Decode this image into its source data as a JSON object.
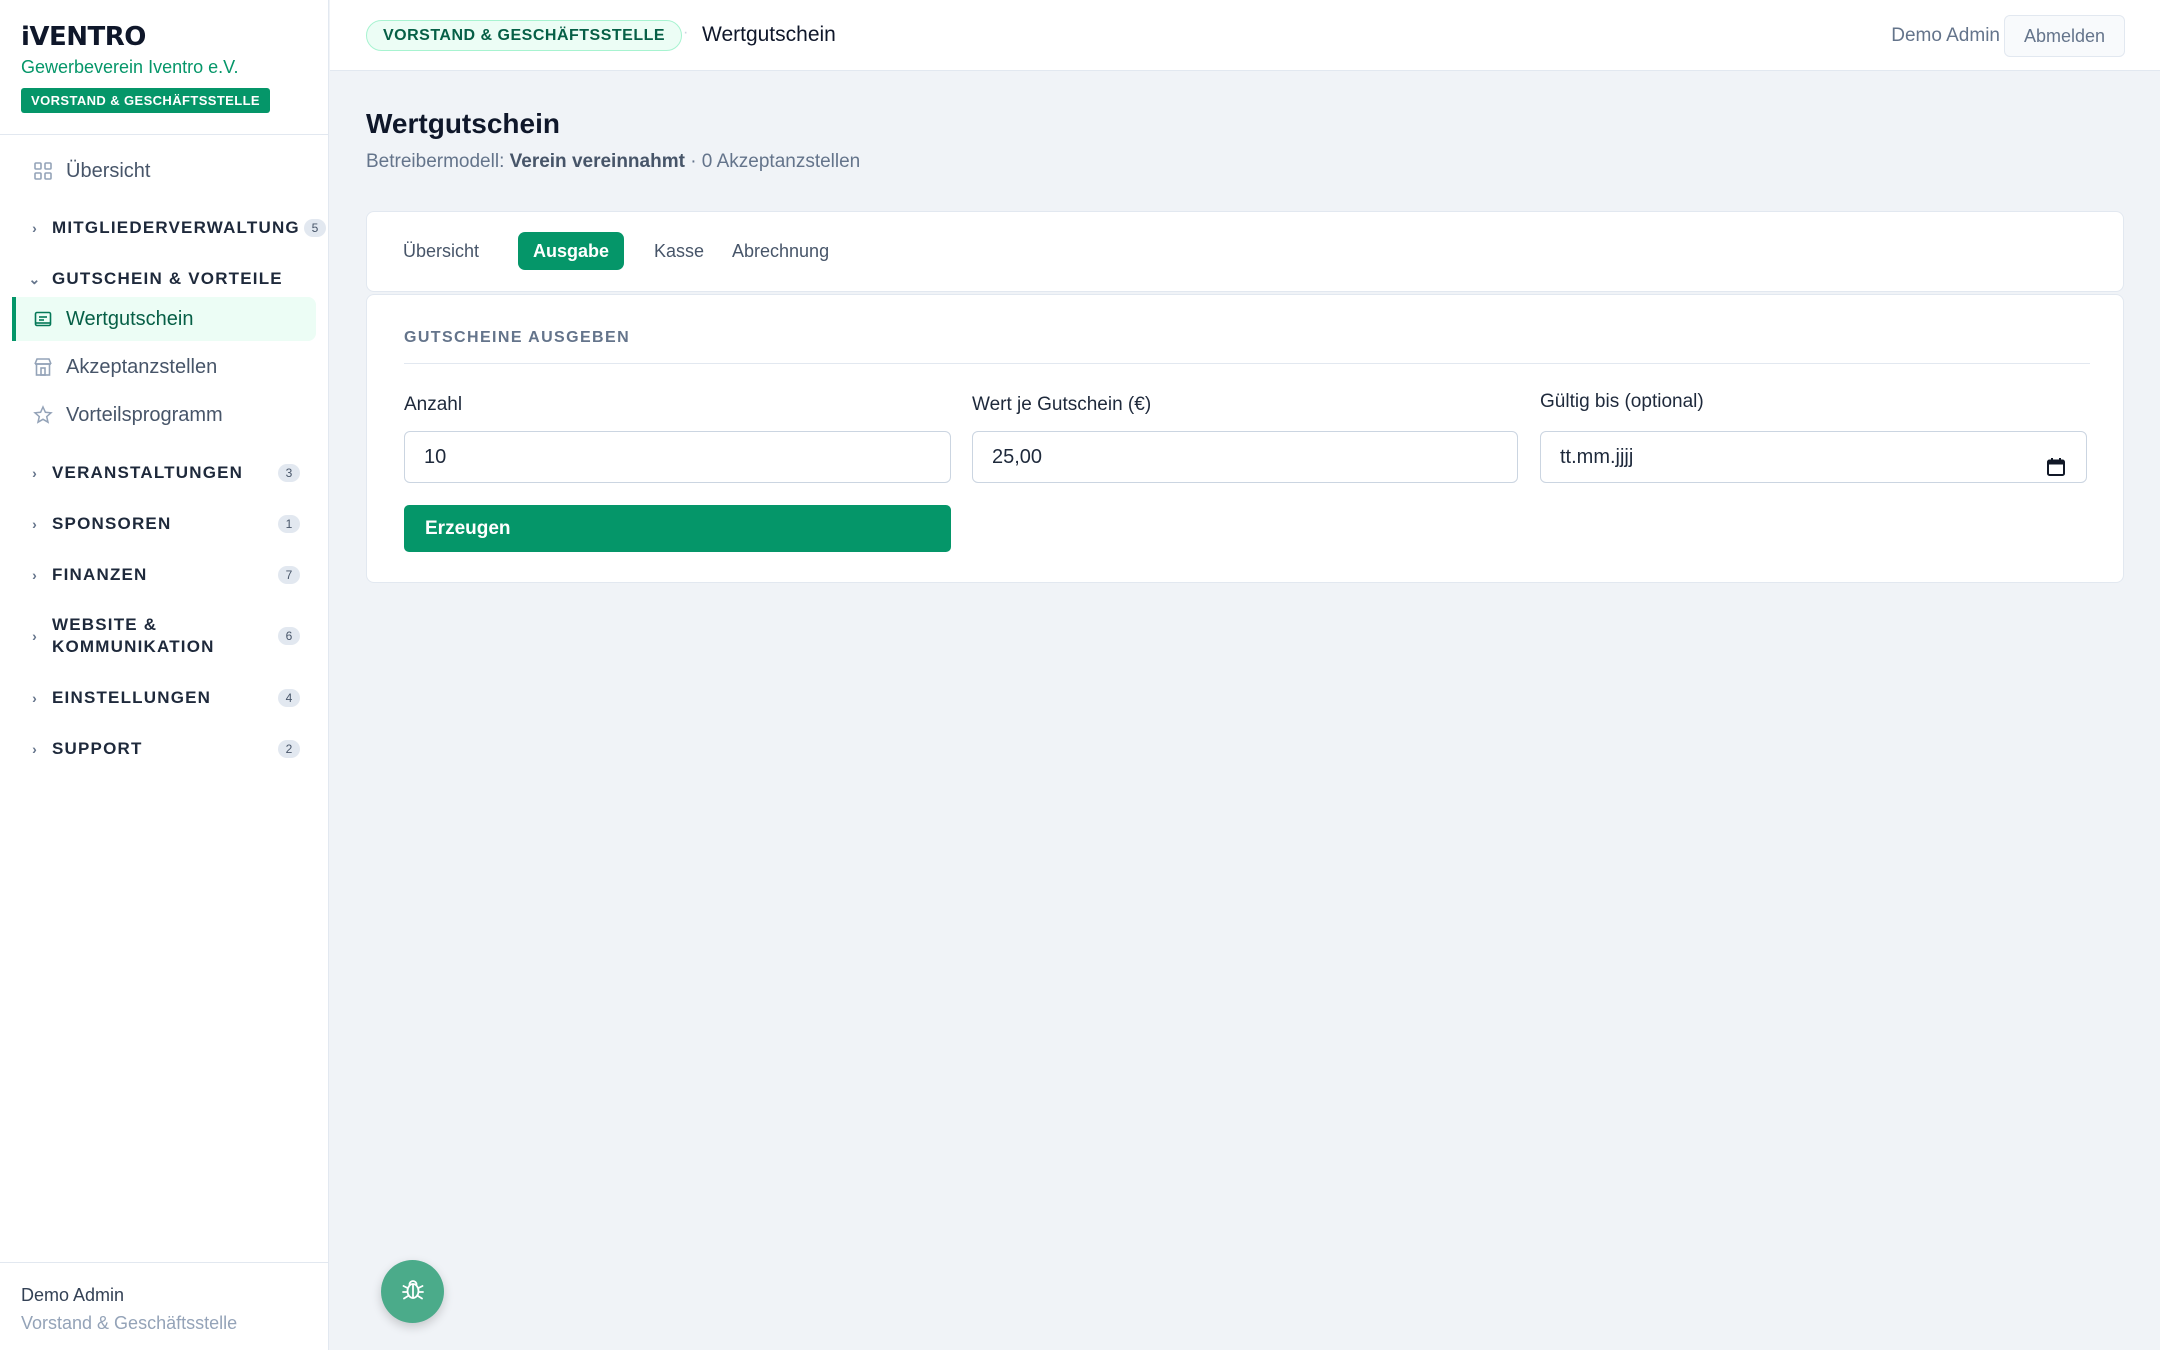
{
  "brand": {
    "name": "iVENTRO",
    "org": "Gewerbeverein Iventro e.V.",
    "role_badge": "VORSTAND & GESCHÄFTSSTELLE"
  },
  "sidebar": {
    "overview": {
      "label": "Übersicht",
      "icon": "grid-icon"
    },
    "groups": [
      {
        "label": "MITGLIEDERVERWALTUNG",
        "count": "5",
        "expanded": false
      },
      {
        "label": "GUTSCHEIN & VORTEILE",
        "expanded": true,
        "items": [
          {
            "label": "Wertgutschein",
            "icon": "voucher-icon",
            "active": true
          },
          {
            "label": "Akzeptanzstellen",
            "icon": "store-icon"
          },
          {
            "label": "Vorteilsprogramm",
            "icon": "star-icon"
          }
        ]
      },
      {
        "label": "VERANSTALTUNGEN",
        "count": "3"
      },
      {
        "label": "SPONSOREN",
        "count": "1"
      },
      {
        "label": "FINANZEN",
        "count": "7"
      },
      {
        "label_line1": "WEBSITE &",
        "label_line2": "KOMMUNIKATION",
        "count": "6"
      },
      {
        "label": "EINSTELLUNGEN",
        "count": "4"
      },
      {
        "label": "SUPPORT",
        "count": "2"
      }
    ],
    "footer": {
      "user": "Demo Admin",
      "role": "Vorstand & Geschäftsstelle"
    }
  },
  "topbar": {
    "badge": "VORSTAND & GESCHÄFTSSTELLE",
    "separator": "·",
    "title": "Wertgutschein",
    "user": "Demo Admin",
    "logout_label": "Abmelden"
  },
  "page": {
    "title": "Wertgutschein",
    "subtitle_prefix": "Betreibermodell: ",
    "subtitle_model": "Verein vereinnahmt",
    "subtitle_suffix": " · 0 Akzeptanzstellen"
  },
  "tabs": [
    {
      "label": "Übersicht",
      "active": false
    },
    {
      "label": "Ausgabe",
      "active": true
    },
    {
      "label": "Kasse",
      "active": false
    },
    {
      "label": "Abrechnung",
      "active": false
    }
  ],
  "form": {
    "section_title": "GUTSCHEINE AUSGEBEN",
    "fields": [
      {
        "label": "Anzahl",
        "value": "10"
      },
      {
        "label": "Wert je Gutschein (€)",
        "value": "25,00"
      },
      {
        "label": "Gültig bis (optional)",
        "value": "tt.mm.jjjj",
        "icon": "calendar-icon"
      }
    ],
    "submit_label": "Erzeugen"
  },
  "fab": {
    "icon": "bug-icon"
  },
  "colors": {
    "accent": "#059669",
    "accent_soft": "#ecfdf5",
    "fab": "#4bab8a",
    "background": "#f0f3f7"
  }
}
